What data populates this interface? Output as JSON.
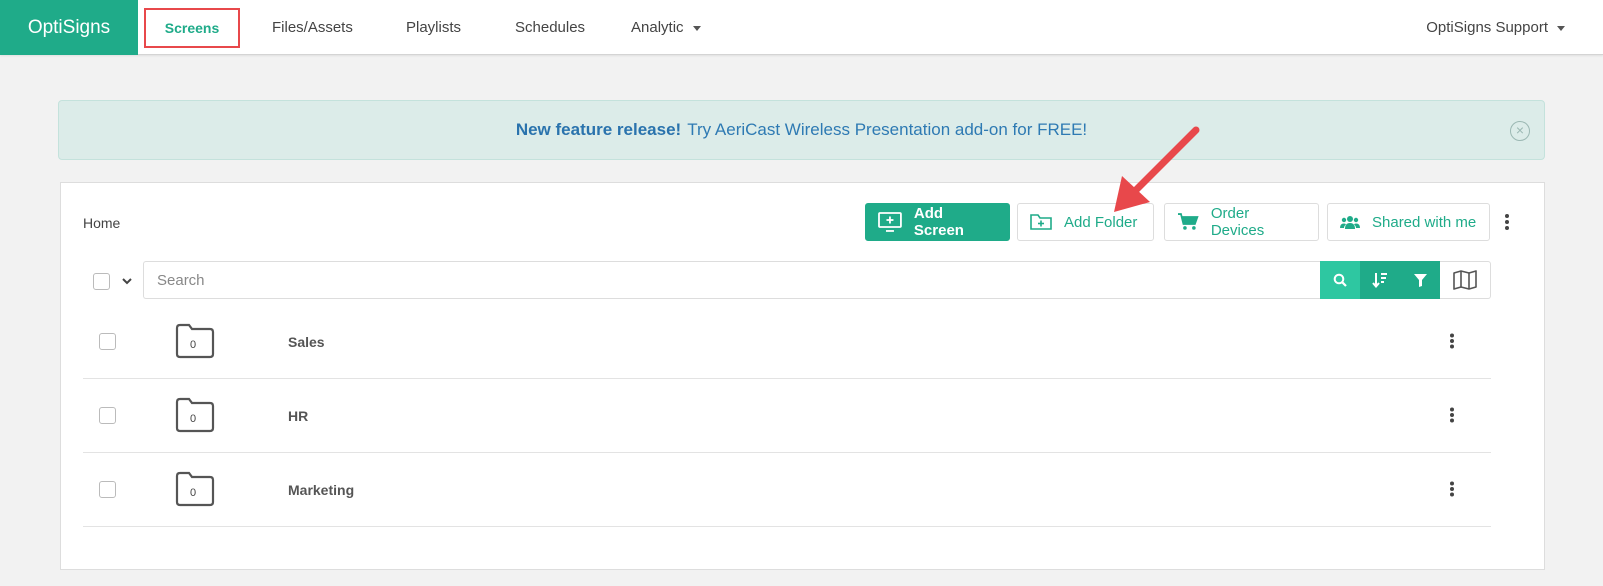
{
  "nav": {
    "brand": "OptiSigns",
    "items": [
      "Screens",
      "Files/Assets",
      "Playlists",
      "Schedules"
    ],
    "analytic": "Analytic",
    "user": "OptiSigns Support"
  },
  "banner": {
    "bold": "New feature release!",
    "text": "Try AeriCast Wireless Presentation add-on for FREE!"
  },
  "toolbar": {
    "breadcrumb": "Home",
    "add_screen": "Add Screen",
    "add_folder": "Add Folder",
    "order_devices": "Order Devices",
    "shared_with_me": "Shared with me",
    "search_placeholder": "Search"
  },
  "folders": [
    {
      "name": "Sales",
      "count": "0"
    },
    {
      "name": "HR",
      "count": "0"
    },
    {
      "name": "Marketing",
      "count": "0"
    }
  ],
  "colors": {
    "brand": "#1fab89",
    "accent_light": "#2ec7a1",
    "highlight": "#e8484b",
    "banner_text": "#2e7ab3"
  }
}
